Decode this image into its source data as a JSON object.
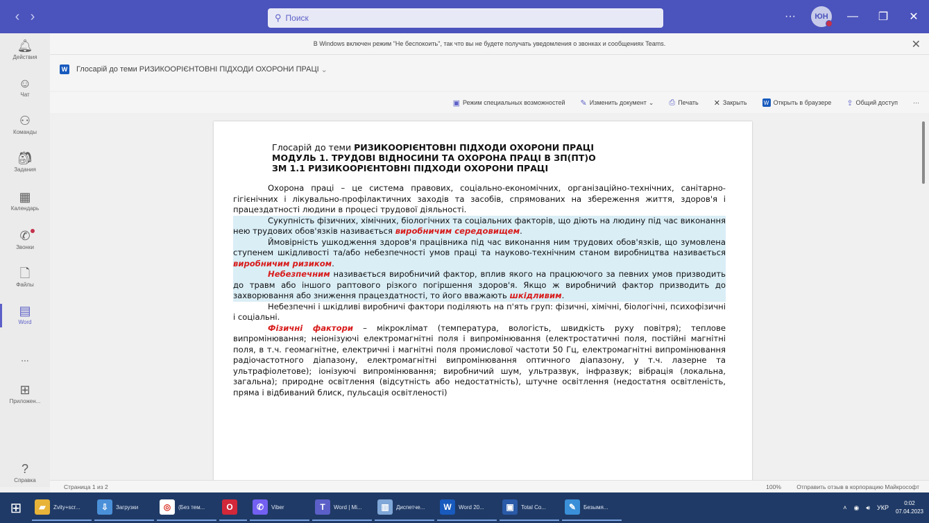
{
  "titlebar": {
    "search_placeholder": "Поиск",
    "avatar_initials": "ЮН",
    "more_label": "···"
  },
  "rail": {
    "items": [
      {
        "label": "Действия",
        "icon": "bell-icon"
      },
      {
        "label": "Чат",
        "icon": "chat-icon"
      },
      {
        "label": "Команды",
        "icon": "teams-icon"
      },
      {
        "label": "Задания",
        "icon": "assignments-icon"
      },
      {
        "label": "Календарь",
        "icon": "calendar-icon"
      },
      {
        "label": "Звонки",
        "icon": "phone-icon"
      },
      {
        "label": "Файлы",
        "icon": "file-icon"
      },
      {
        "label": "Word",
        "icon": "word-icon"
      },
      {
        "label": "...",
        "icon": "more-icon"
      },
      {
        "label": "Приложен...",
        "icon": "apps-icon"
      },
      {
        "label": "Справка",
        "icon": "help-icon"
      }
    ]
  },
  "notice": {
    "text": "В Windows включен режим \"Не беспокоить\", так что вы не будете получать уведомления о звонках и сообщениях Teams."
  },
  "document": {
    "title": "Глосарій до теми РИЗИКООРІЄНТОВНІ ПІДХОДИ ОХОРОНИ ПРАЦІ",
    "toolbar": {
      "accessibility": "Режим специальных возможностей",
      "edit": "Изменить документ",
      "print": "Печать",
      "close": "Закрыть",
      "open_browser": "Открыть в браузере",
      "share": "Общий доступ",
      "more": "···"
    },
    "heading": {
      "line1_prefix": "Глосарій до теми",
      "line1_bold": "РИЗИКООРІЄНТОВНІ ПІДХОДИ ОХОРОНИ ПРАЦІ",
      "line2": "МОДУЛЬ 1. ТРУДОВІ ВІДНОСИНИ ТА ОХОРОНА ПРАЦІ В ЗП(ПТ)О",
      "line3": "ЗМ 1.1  РИЗИКООРІЄНТОВНІ ПІДХОДИ ОХОРОНИ ПРАЦІ"
    },
    "paragraphs": {
      "p1": "Охорона праці – це система правових, соціально-економічних, організаційно-технічних, санітарно-гігієнічних і лікувально-профілактичних заходів та засобів, спрямованих на збереження життя, здоров'я і працездатності людини в процесі трудової діяльності.",
      "p2_text": "Сукупність фізичних, хімічних, біологічних та соціальних факторів, що діють на людину під час виконання нею трудових обов'язків називається ",
      "p2_term": "виробничим середовищем",
      "p3_text": "Ймовірність ушкодження здоров'я працівника під час виконання ним трудових обов'язків, що зумовлена ступенем шкідливості та/або небезпечності умов праці та науково-технічним станом виробництва називається ",
      "p3_term": "виробничим ризиком",
      "p4_term1": "Небезпечним",
      "p4_text": " називається виробничий фактор, вплив якого на працюючого за певних умов призводить до травм або іншого раптового різкого погіршення здоров'я. Якщо ж виробничий фактор призводить до захворювання або зниження працездатності, то його вважають ",
      "p4_term2": "шкідливим",
      "p5": "Небезпечні і шкідливі виробничі фактори поділяють на п'ять груп: фізичні, хімічні, біологічні, психофізичні і соціальні.",
      "p6_term": "Фізичні фактори",
      "p6_text": " – мікроклімат (температура, вологість, швидкість руху повітря); теплове випромінювання; неіонізуючі електромагнітні поля і випромінювання (електростатичні поля, постійні магнітні поля, в т.ч. геомагнітне, електричні і магнітні поля промислової частоти 50 Гц, електромагнітні випромінювання радіочастотного діапазону, електромагнітні випромінювання оптичного діапазону, у т.ч. лазерне та ультрафіолетове); іонізуючі випромінювання; виробничий шум, ультразвук, інфразвук; вібрація (локальна, загальна); природне освітлення (відсутність або недостатність), штучне освітлення (недостатня освітленість, пряма і відбиваний блиск, пульсація освітленості)"
    }
  },
  "status": {
    "page": "Страница 1 из 2",
    "zoom": "100%",
    "feedback": "Отправить отзыв в корпорацию Майкрософт"
  },
  "taskbar": {
    "items": [
      {
        "label": "Zvity+scr...",
        "icon": "folder-icon",
        "color": "#e8b339"
      },
      {
        "label": "Загрузки",
        "icon": "downloads-folder-icon",
        "color": "#4a90d9"
      },
      {
        "label": "(Без тем...",
        "icon": "chrome-icon",
        "color": "#ffffff"
      },
      {
        "label": "",
        "icon": "opera-icon",
        "color": "#d2283a"
      },
      {
        "label": "Viber",
        "icon": "viber-icon",
        "color": "#7360f2"
      },
      {
        "label": "Word | Mi...",
        "icon": "teams-icon",
        "color": "#5b5fc7"
      },
      {
        "label": "Диспетче...",
        "icon": "task-manager-icon",
        "color": "#7fa7d8"
      },
      {
        "label": "Word 20...",
        "icon": "word-icon",
        "color": "#185abd"
      },
      {
        "label": "Total Co...",
        "icon": "total-commander-icon",
        "color": "#2a5aa8"
      },
      {
        "label": "Безымя...",
        "icon": "paint-icon",
        "color": "#3a8fd8"
      }
    ],
    "lang": "УКР",
    "time": "0:02",
    "date": "07.04.2023"
  }
}
